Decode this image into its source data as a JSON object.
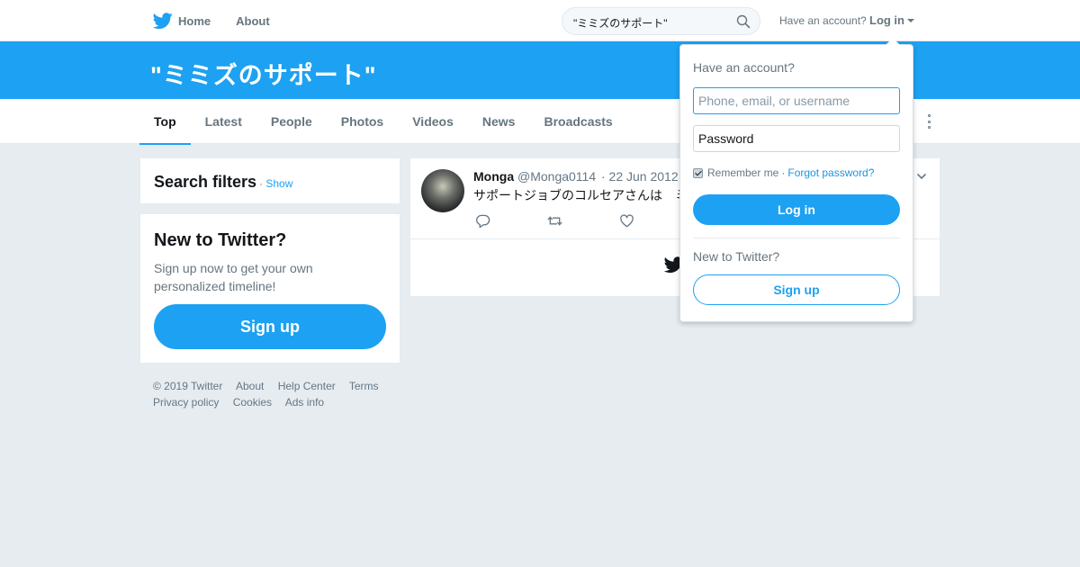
{
  "nav": {
    "home_label": "Home",
    "about_label": "About",
    "search_value": "\"ミミズのサポート\"",
    "have_account_text": "Have an account?",
    "login_label": "Log in"
  },
  "banner": {
    "query_title": "\"ミミズのサポート\""
  },
  "tabs": [
    {
      "label": "Top",
      "active": true
    },
    {
      "label": "Latest"
    },
    {
      "label": "People"
    },
    {
      "label": "Photos"
    },
    {
      "label": "Videos"
    },
    {
      "label": "News"
    },
    {
      "label": "Broadcasts"
    }
  ],
  "filters": {
    "title": "Search filters",
    "separator": "·",
    "show_label": "Show"
  },
  "new_to_twitter": {
    "title": "New to Twitter?",
    "text": "Sign up now to get your own personalized timeline!",
    "signup_label": "Sign up"
  },
  "footer": {
    "copyright": "© 2019 Twitter",
    "links": [
      "About",
      "Help Center",
      "Terms",
      "Privacy policy",
      "Cookies",
      "Ads info"
    ]
  },
  "tweet": {
    "name": "Monga",
    "handle": "@Monga0114",
    "time": "· 22 Jun 2012",
    "text": "サポートジョブのコルセアさんは　ミ"
  },
  "login_dropdown": {
    "heading": "Have an account?",
    "username_placeholder": "Phone, email, or username",
    "password_placeholder": "Password",
    "remember_label": "Remember me",
    "separator": "·",
    "forgot_label": "Forgot password?",
    "login_button": "Log in",
    "new_heading": "New to Twitter?",
    "signup_button": "Sign up"
  },
  "colors": {
    "brand_blue": "#1da1f2",
    "page_bg": "#e6ecf0",
    "muted_text": "#66757f"
  }
}
